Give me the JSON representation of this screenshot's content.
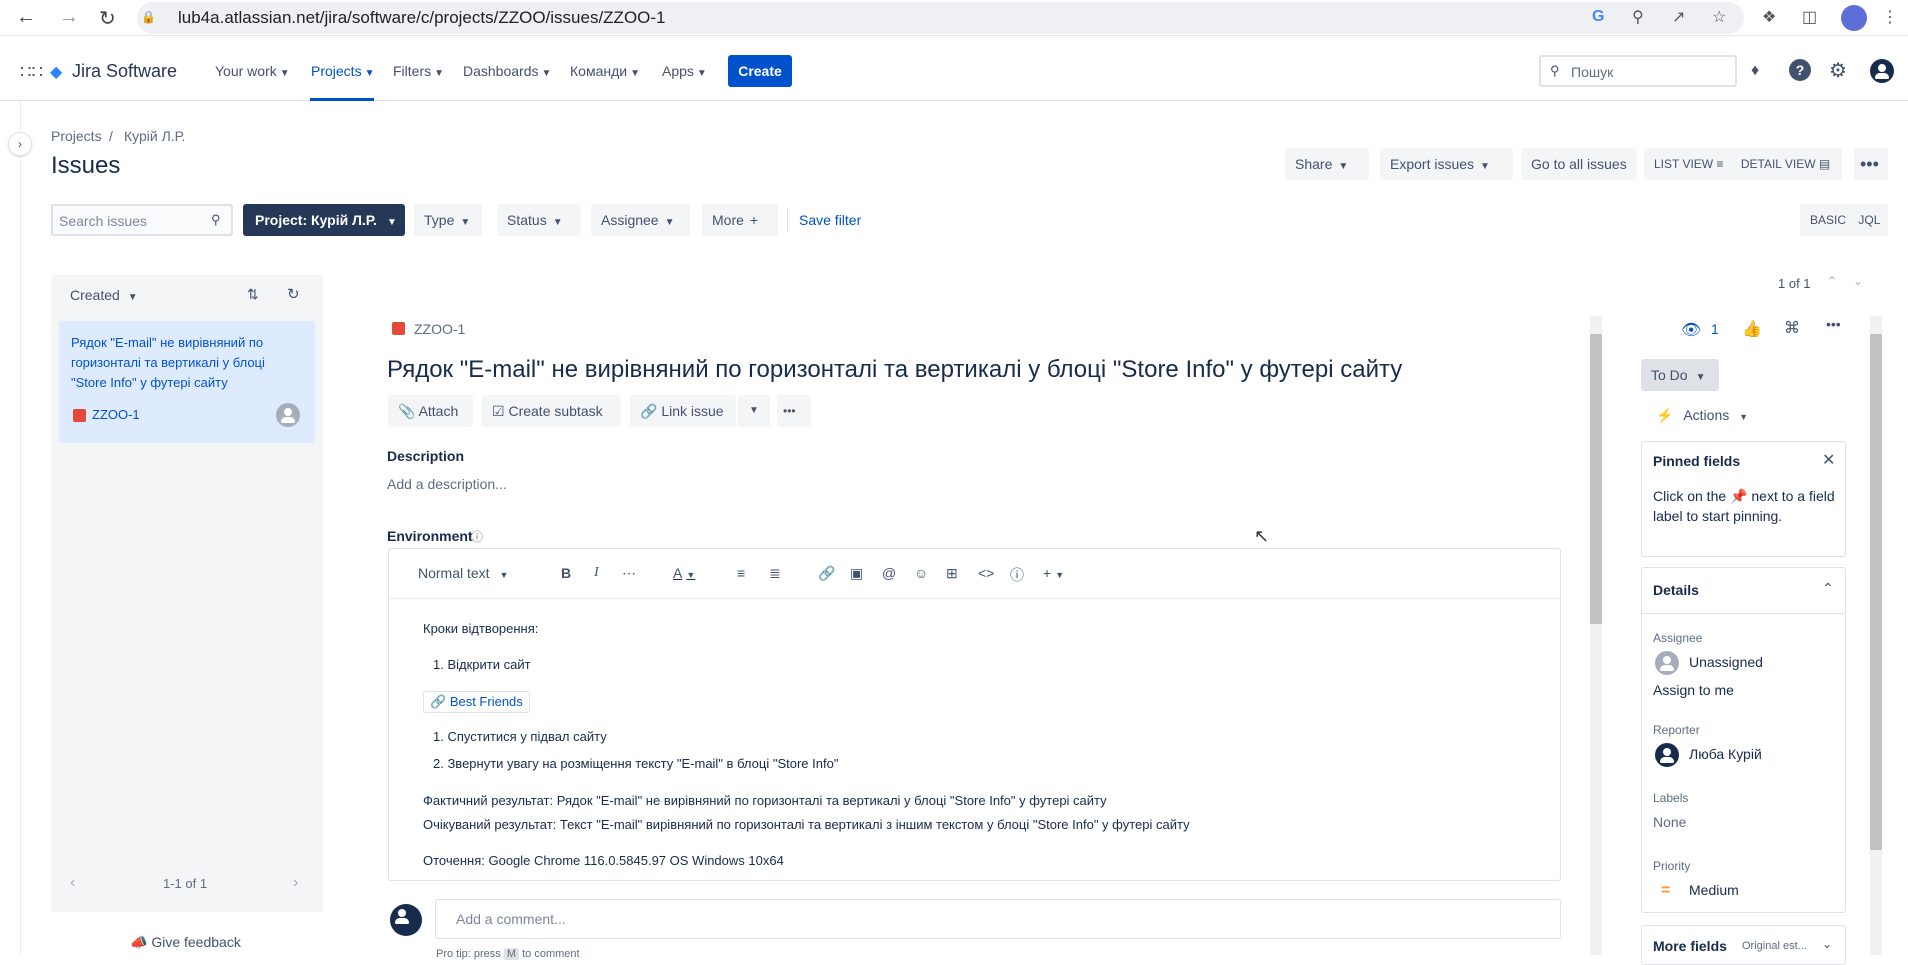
{
  "browser": {
    "url": "lub4a.atlassian.net/jira/software/c/projects/ZZOO/issues/ZZOO-1"
  },
  "nav": {
    "logo": "Jira Software",
    "your_work": "Your work",
    "projects": "Projects",
    "filters": "Filters",
    "dashboards": "Dashboards",
    "teams": "Команди",
    "apps": "Apps",
    "create": "Create",
    "search_placeholder": "Пошук"
  },
  "header": {
    "breadcrumb_projects": "Projects",
    "breadcrumb_sep": "/",
    "breadcrumb_project": "Курій Л.Р.",
    "title": "Issues",
    "share": "Share",
    "export": "Export issues",
    "go_all": "Go to all issues",
    "list_view": "LIST VIEW",
    "detail_view": "DETAIL VIEW"
  },
  "filters": {
    "search_placeholder": "Search issues",
    "project": "Project: Курій Л.Р.",
    "type": "Type",
    "status": "Status",
    "assignee": "Assignee",
    "more": "More",
    "save_filter": "Save filter",
    "basic": "BASIC",
    "jql": "JQL"
  },
  "issue_list": {
    "sort": "Created",
    "card_title": "Рядок \"E-mail\" не вирівняний по горизонталі та вертикалі у блоці \"Store Info\" у футері сайту",
    "card_key": "ZZOO-1",
    "pagination": "1-1 of 1",
    "feedback": "Give feedback"
  },
  "issue": {
    "counter": "1 of 1",
    "key": "ZZOO-1",
    "title": "Рядок \"E-mail\" не вирівняний по горизонталі та вертикалі у блоці \"Store Info\" у футері сайту",
    "attach": "Attach",
    "create_subtask": "Create subtask",
    "link_issue": "Link issue",
    "description_label": "Description",
    "description_placeholder": "Add a description...",
    "environment_label": "Environment",
    "text_style": "Normal text",
    "env": {
      "steps_header": "Кроки відтворення:",
      "step1": "1. Відкрити сайт",
      "link_chip": "Best Friends",
      "step2a": "1. Спуститися у підвал сайту",
      "step2b": "2. Звернути увагу на розміщення тексту \"E-mail\" в  блоці \"Store Info\"",
      "actual": "Фактичний результат: Рядок \"E-mail\" не вирівняний по горизонталі та вертикалі у блоці \"Store Info\" у футері сайту",
      "expected": "Очікуваний результат: Текст \"E-mail\" вирівняний по горизонталі та вертикалі з іншим текстом  у блоці \"Store Info\" у футері сайту",
      "environment": "Оточення:  Google Chrome 116.0.5845.97 OS Windows 10x64"
    },
    "comment_placeholder": "Add a comment...",
    "pro_tip": "Pro tip: press",
    "pro_tip_key": "M",
    "pro_tip_end": "to comment"
  },
  "side": {
    "watchers": "1",
    "status": "To Do",
    "actions": "Actions",
    "pinned_title": "Pinned fields",
    "pinned_text_1": "Click on the",
    "pinned_text_2": "next to a",
    "pinned_text_3": "field label to start",
    "pinned_text_4": "pinning.",
    "details_title": "Details",
    "assignee_label": "Assignee",
    "assignee_value": "Unassigned",
    "assign_to_me": "Assign to me",
    "reporter_label": "Reporter",
    "reporter_value": "Люба Курій",
    "labels_label": "Labels",
    "labels_value": "None",
    "priority_label": "Priority",
    "priority_value": "Medium",
    "more_fields": "More fields",
    "more_fields_sub": "Original est..."
  },
  "colors": {
    "primary": "#0052cc",
    "dark_button": "#253858",
    "selected_card": "#deebff",
    "bug": "#e5493a",
    "priority_medium": "#ff991f"
  }
}
